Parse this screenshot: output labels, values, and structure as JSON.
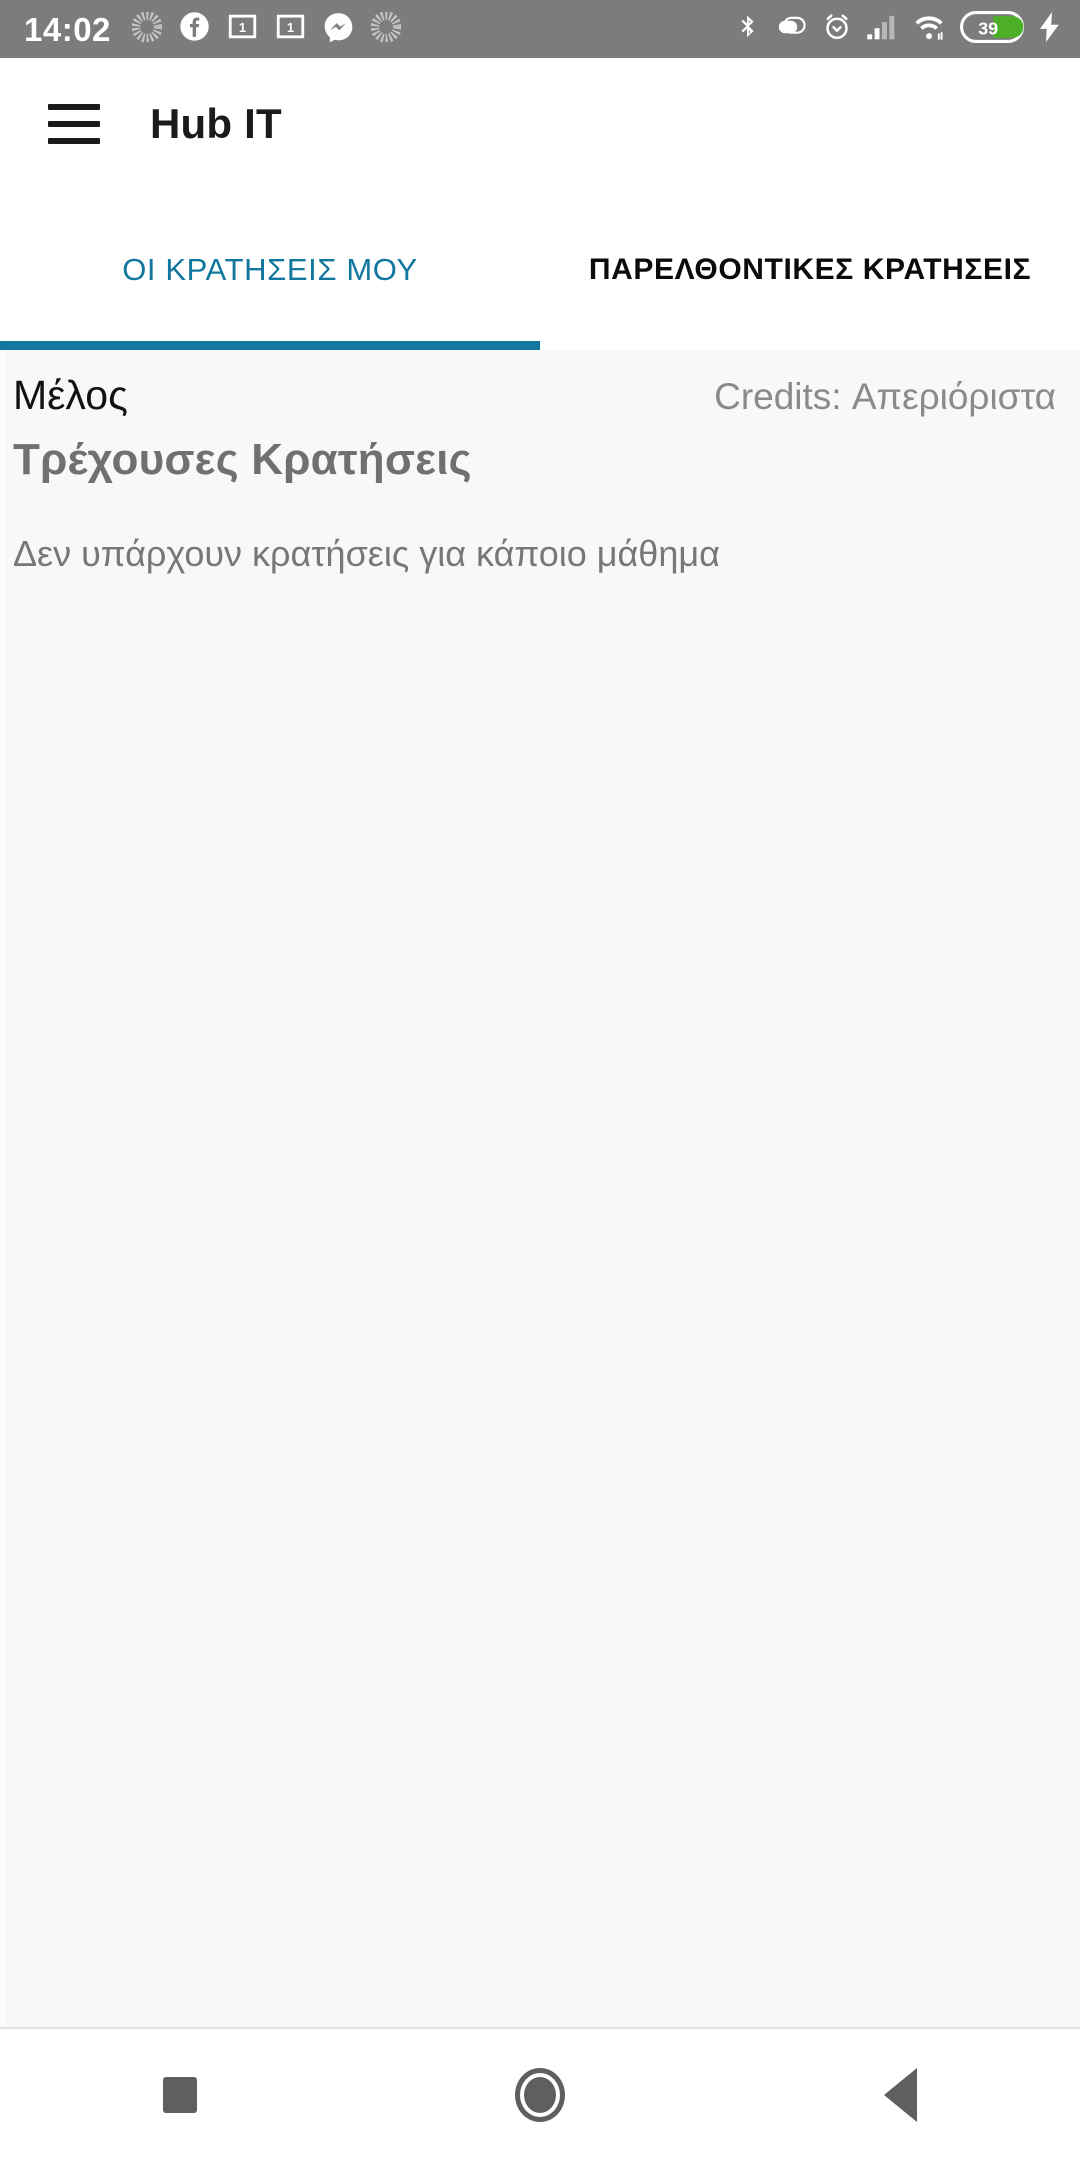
{
  "statusbar": {
    "clock": "14:02",
    "left_icons": [
      {
        "name": "sync-spinner-icon",
        "glyph": "spinner"
      },
      {
        "name": "facebook-icon",
        "glyph": "facebook"
      },
      {
        "name": "notification-badge-1-icon",
        "glyph": "badge1",
        "badge": "1"
      },
      {
        "name": "notification-badge-2-icon",
        "glyph": "badge1",
        "badge": "1"
      },
      {
        "name": "messenger-icon",
        "glyph": "messenger"
      },
      {
        "name": "sync-spinner-2-icon",
        "glyph": "spinner"
      }
    ],
    "right_icons": [
      {
        "name": "bluetooth-icon",
        "glyph": "bluetooth"
      },
      {
        "name": "data-saver-icon",
        "glyph": "capsule"
      },
      {
        "name": "alarm-icon",
        "glyph": "alarm"
      },
      {
        "name": "cellular-signal-icon",
        "glyph": "signal"
      },
      {
        "name": "wifi-icon",
        "glyph": "wifi"
      },
      {
        "name": "battery-icon",
        "glyph": "battery"
      },
      {
        "name": "charging-bolt-icon",
        "glyph": "bolt"
      }
    ],
    "battery_level": "39",
    "battery_color": "#4caf25",
    "background_color": "#7c7c7c"
  },
  "appbar": {
    "menu_label": "menu",
    "title": "Hub IT"
  },
  "tabs": {
    "accent_color": "#11779e",
    "items": [
      {
        "label": "ΟΙ ΚΡΑΤΗΣΕΙΣ ΜΟΥ",
        "active": true
      },
      {
        "label": "ΠΑΡΕΛΘΟΝΤΙΚΕΣ ΚΡΑΤΗΣΕΙΣ",
        "active": false
      }
    ]
  },
  "content": {
    "member_label": "Μέλος",
    "credits_label": "Credits: Απεριόριστα",
    "section_title": "Τρέχουσες Κρατήσεις",
    "empty_message": "Δεν υπάρχουν κρατήσεις για κάποιο μάθημα",
    "background_color": "#f8f8f8"
  },
  "navbar": {
    "recents_label": "recents",
    "home_label": "home",
    "back_label": "back"
  }
}
